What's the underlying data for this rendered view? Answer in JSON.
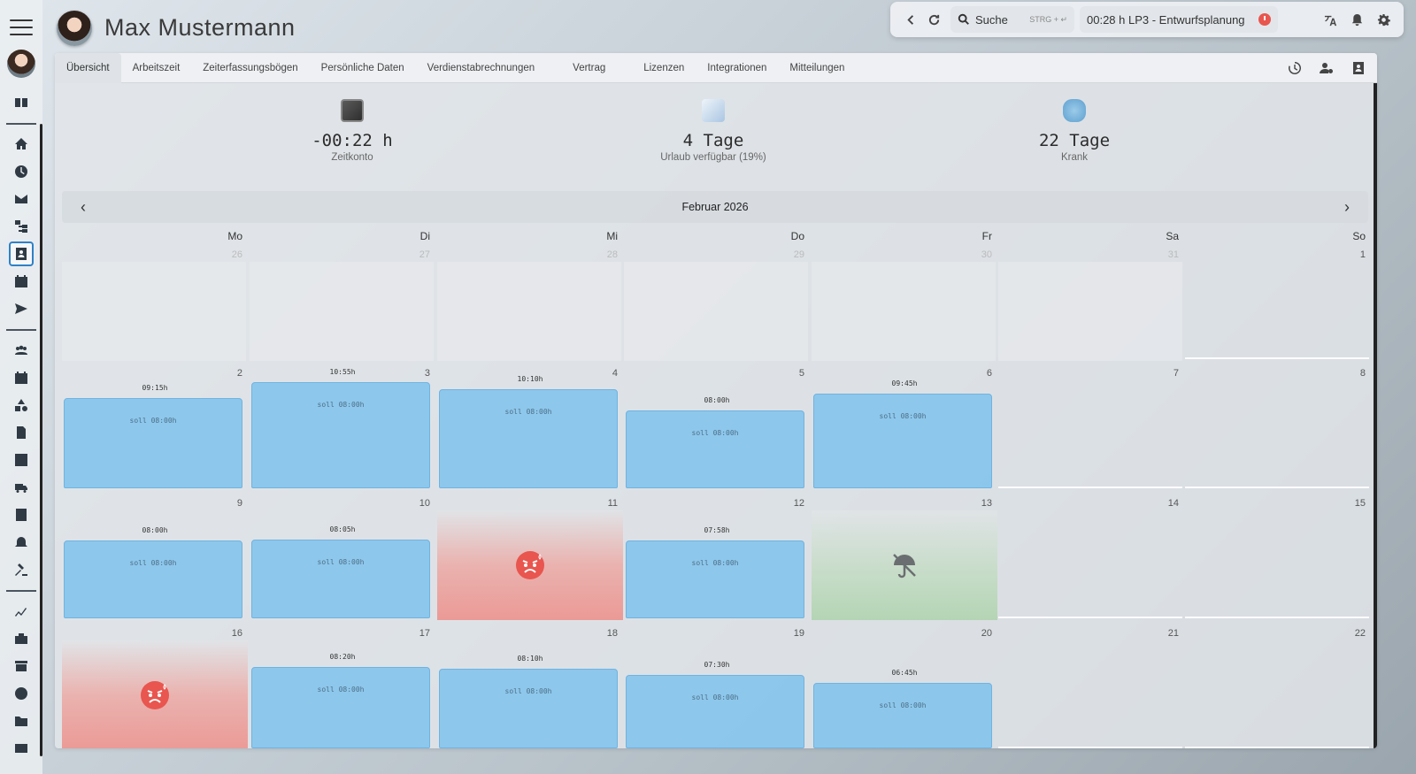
{
  "user": {
    "name": "Max Mustermann"
  },
  "topbar": {
    "search_label": "Suche",
    "search_shortcut": "STRG + ↵",
    "timer_time": "00:28 h",
    "timer_project": "LP3 - Entwurfsplanung"
  },
  "tabs": [
    "Übersicht",
    "Arbeitszeit",
    "Zeiterfassungsbögen",
    "Persönliche Daten",
    "Verdienstabrechnungen",
    "Vertrag",
    "Lizenzen",
    "Integrationen",
    "Mitteilungen"
  ],
  "stats": [
    {
      "value": "-00:22 h",
      "label": "Zeitkonto"
    },
    {
      "value": "4 Tage",
      "label": "Urlaub verfügbar (19%)"
    },
    {
      "value": "22 Tage",
      "label": "Krank"
    }
  ],
  "calendar": {
    "month": "Februar 2026",
    "weekdays": [
      "Mo",
      "Di",
      "Mi",
      "Do",
      "Fr",
      "Sa",
      "So"
    ],
    "weeks": [
      [
        {
          "day": "26",
          "faded": true
        },
        {
          "day": "27",
          "faded": true
        },
        {
          "day": "28",
          "faded": true
        },
        {
          "day": "29",
          "faded": true
        },
        {
          "day": "30",
          "faded": true
        },
        {
          "day": "31",
          "faded": true
        },
        {
          "day": "1"
        }
      ],
      [
        {
          "day": "2",
          "type": "work",
          "ist": "09:15h",
          "soll": "soll 08:00h",
          "hours": 9.25
        },
        {
          "day": "3",
          "type": "work",
          "ist": "10:55h",
          "soll": "soll 08:00h",
          "hours": 10.92
        },
        {
          "day": "4",
          "type": "work",
          "ist": "10:10h",
          "soll": "soll 08:00h",
          "hours": 10.17
        },
        {
          "day": "5",
          "type": "work",
          "ist": "08:00h",
          "soll": "soll 08:00h",
          "hours": 8.0
        },
        {
          "day": "6",
          "type": "work",
          "ist": "09:45h",
          "soll": "soll 08:00h",
          "hours": 9.75
        },
        {
          "day": "7"
        },
        {
          "day": "8"
        }
      ],
      [
        {
          "day": "9",
          "type": "work",
          "ist": "08:00h",
          "soll": "soll 08:00h",
          "hours": 8.0
        },
        {
          "day": "10",
          "type": "work",
          "ist": "08:05h",
          "soll": "soll 08:00h",
          "hours": 8.08
        },
        {
          "day": "11",
          "type": "sick"
        },
        {
          "day": "12",
          "type": "work",
          "ist": "07:58h",
          "soll": "soll 08:00h",
          "hours": 7.97
        },
        {
          "day": "13",
          "type": "vacation"
        },
        {
          "day": "14"
        },
        {
          "day": "15"
        }
      ],
      [
        {
          "day": "16",
          "type": "sick"
        },
        {
          "day": "17",
          "type": "work",
          "ist": "08:20h",
          "soll": "soll 08:00h",
          "hours": 8.33
        },
        {
          "day": "18",
          "type": "work",
          "ist": "08:10h",
          "soll": "soll 08:00h",
          "hours": 8.17
        },
        {
          "day": "19",
          "type": "work",
          "ist": "07:30h",
          "soll": "soll 08:00h",
          "hours": 7.5
        },
        {
          "day": "20",
          "type": "work",
          "ist": "06:45h",
          "soll": "soll 08:00h",
          "hours": 6.75
        },
        {
          "day": "21"
        },
        {
          "day": "22"
        }
      ]
    ]
  }
}
